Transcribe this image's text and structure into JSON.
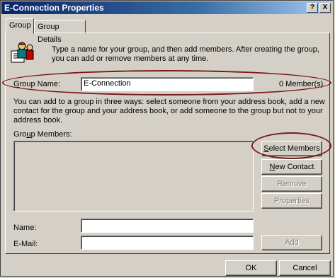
{
  "window": {
    "title": "E-Connection Properties",
    "help_label": "?",
    "close_label": "X"
  },
  "tabs": [
    {
      "label": "Group"
    },
    {
      "label": "Group Details"
    }
  ],
  "intro": "Type a name for your group, and then add members. After creating the group, you can add or remove members at any time.",
  "group_name": {
    "label": "Group Name:",
    "value": "E-Connection",
    "members_count": "0 Member(s)"
  },
  "instructions": "You can add to a group in three ways: select someone from your address book, add a new contact for the group and your address book, or add someone to the group but not to your address book.",
  "members": {
    "label": "Group Members:",
    "items": []
  },
  "buttons": {
    "select_members": "Select Members",
    "new_contact": "New Contact",
    "remove": "Remove",
    "properties": "Properties",
    "add": "Add",
    "ok": "OK",
    "cancel": "Cancel"
  },
  "fields": {
    "name_label": "Name:",
    "name_value": "",
    "email_label": "E-Mail:",
    "email_value": ""
  },
  "colors": {
    "highlight_oval": "#7a1a1a",
    "titlebar": "#0a246a"
  }
}
